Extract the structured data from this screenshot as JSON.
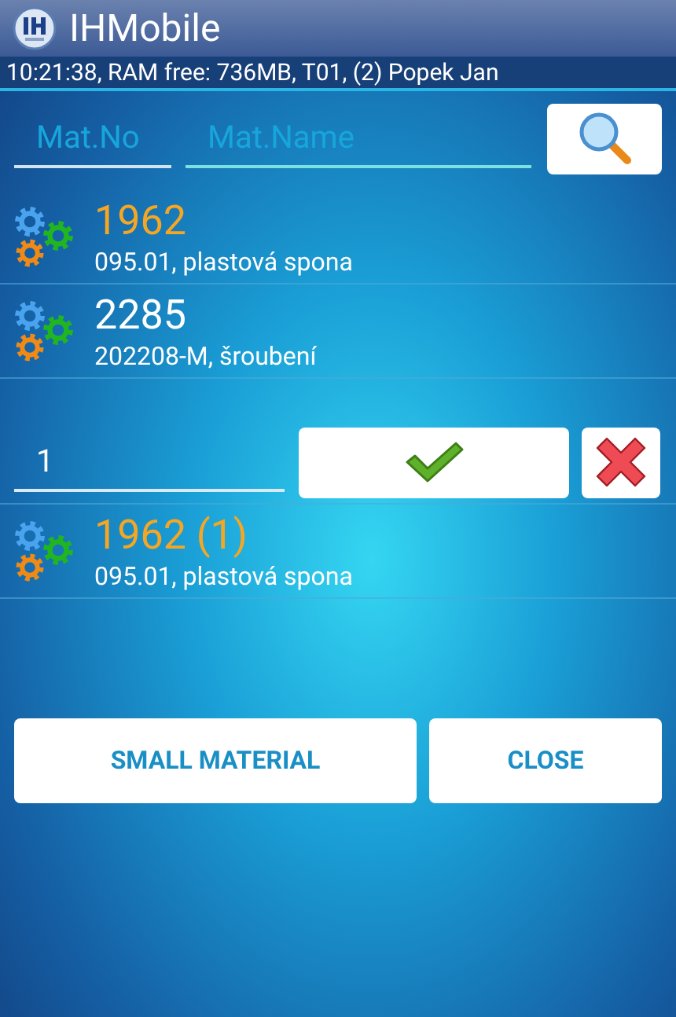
{
  "app": {
    "title": "IHMobile"
  },
  "status_line": "10:21:38, RAM free: 736MB, T01, (2) Popek Jan",
  "search": {
    "fields": [
      {
        "placeholder": "Mat.No",
        "focused": false
      },
      {
        "placeholder": "Mat.Name",
        "focused": true
      }
    ]
  },
  "materials": [
    {
      "number": "1962",
      "description": "095.01, plastová spona",
      "selected": true
    },
    {
      "number": "2285",
      "description": "202208-M, šroubení",
      "selected": false
    }
  ],
  "quantity": {
    "value": "1"
  },
  "cart": [
    {
      "number": "1962 (1)",
      "description": "095.01, plastová spona",
      "selected": true
    }
  ],
  "buttons": [
    "SMALL MATERIAL",
    "CLOSE"
  ]
}
